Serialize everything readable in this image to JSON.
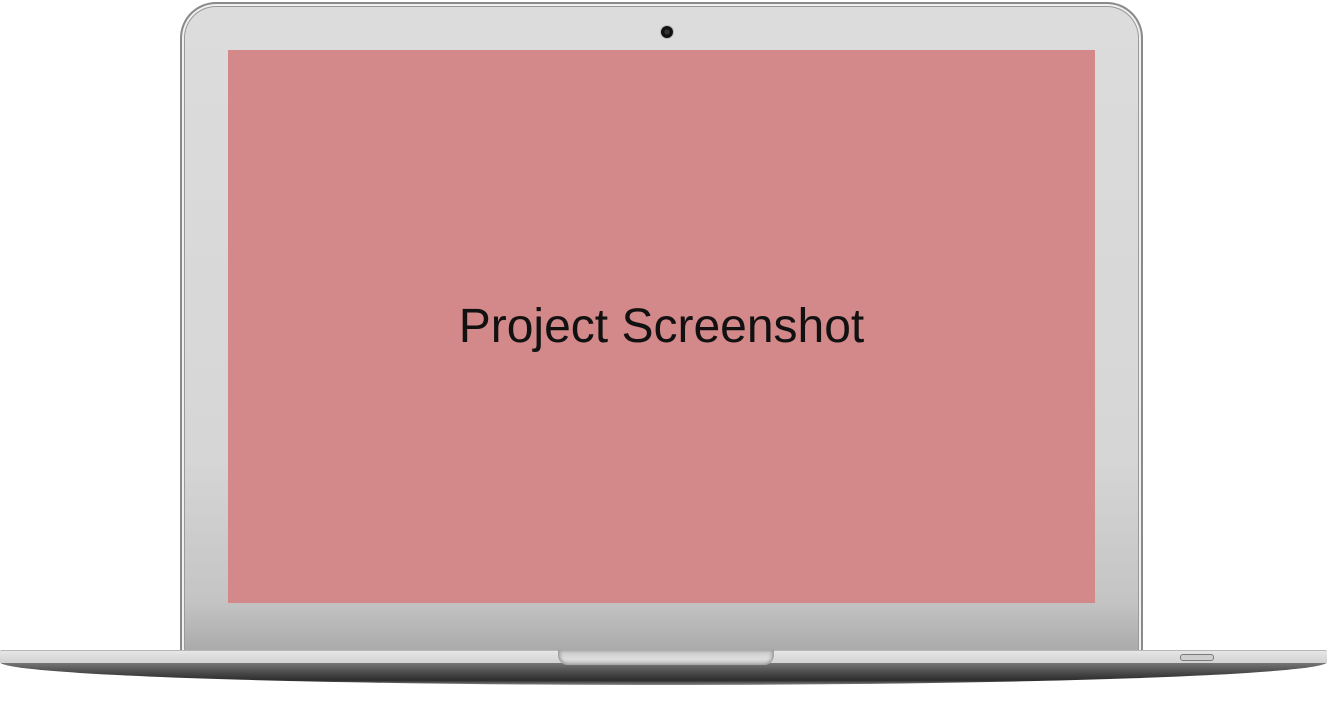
{
  "screen": {
    "text": "Project Screenshot",
    "background_color": "#d38889"
  },
  "device": {
    "type": "laptop",
    "frame_color": "#dcdcdc"
  }
}
